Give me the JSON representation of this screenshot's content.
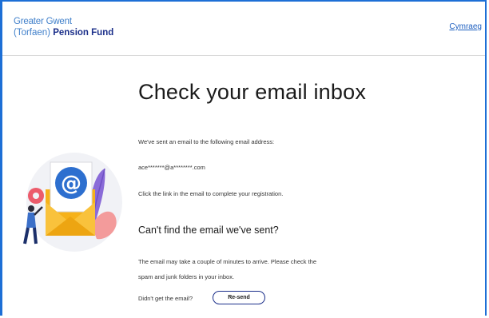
{
  "header": {
    "logo_line1": "Greater Gwent",
    "logo_line2_prefix": "(Torfaen) ",
    "logo_line2_bold": "Pension Fund",
    "language_link": "Cymraeg"
  },
  "main": {
    "title": "Check your email inbox",
    "sent_text": "We've sent an email to the following email address:",
    "email": "ace*******@a********.com",
    "instruction": "Click the link in the email to complete your registration.",
    "subheading": "Can't find the email we've sent?",
    "help_line1": "The email may take a couple of minutes to arrive. Please check the",
    "help_line2": "spam and junk folders in your inbox.",
    "didnt_get": "Didn't get the email?",
    "resend_label": "Re-send"
  },
  "colors": {
    "frame_border": "#1d6fd6",
    "brand_navy": "#1b2f8a",
    "brand_blue": "#3f7fca",
    "illustration_yellow": "#f6b21a",
    "illustration_purple": "#8a6bd8",
    "illustration_pink": "#f28a8a"
  },
  "illustration": {
    "icon": "email-at-icon"
  }
}
